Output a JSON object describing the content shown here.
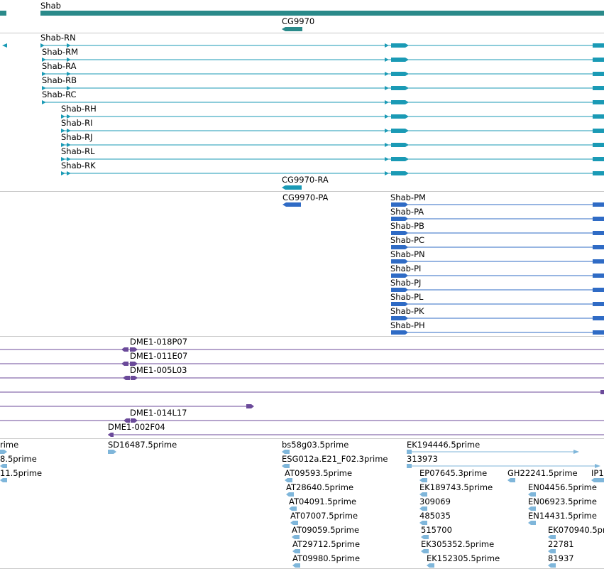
{
  "colors": {
    "gene": "#2a8a8a",
    "rna": "#1a9ab5",
    "protein": "#2f6bc5",
    "clone": "#6b4a9a",
    "est": "#7fb6da",
    "separator": "#c8c8c8"
  },
  "genes": [
    {
      "label": "Shab"
    },
    {
      "label": "CG9970"
    }
  ],
  "transcripts": [
    {
      "label": "Shab-RN"
    },
    {
      "label": "Shab-RM"
    },
    {
      "label": "Shab-RA"
    },
    {
      "label": "Shab-RB"
    },
    {
      "label": "Shab-RC"
    },
    {
      "label": "Shab-RH"
    },
    {
      "label": "Shab-RI"
    },
    {
      "label": "Shab-RJ"
    },
    {
      "label": "Shab-RL"
    },
    {
      "label": "Shab-RK"
    },
    {
      "label": "CG9970-RA"
    }
  ],
  "proteins": [
    {
      "label": "CG9970-PA"
    },
    {
      "label": "Shab-PM"
    },
    {
      "label": "Shab-PA"
    },
    {
      "label": "Shab-PB"
    },
    {
      "label": "Shab-PC"
    },
    {
      "label": "Shab-PN"
    },
    {
      "label": "Shab-PI"
    },
    {
      "label": "Shab-PJ"
    },
    {
      "label": "Shab-PL"
    },
    {
      "label": "Shab-PK"
    },
    {
      "label": "Shab-PH"
    }
  ],
  "clones": [
    {
      "label": "DME1-018P07"
    },
    {
      "label": "DME1-011E07"
    },
    {
      "label": "DME1-005L03"
    },
    {
      "label": ""
    },
    {
      "label": ""
    },
    {
      "label": "DME1-014L17"
    },
    {
      "label": "DME1-002F04"
    }
  ],
  "ests": [
    {
      "label": "rime"
    },
    {
      "label": "8.5prime"
    },
    {
      "label": "11.5prime"
    },
    {
      "label": "SD16487.5prime"
    },
    {
      "label": "bs58g03.5prime"
    },
    {
      "label": "ESG012a.E21_F02.3prime"
    },
    {
      "label": "AT09593.5prime"
    },
    {
      "label": "AT28640.5prime"
    },
    {
      "label": "AT04091.5prime"
    },
    {
      "label": "AT07007.5prime"
    },
    {
      "label": "AT09059.5prime"
    },
    {
      "label": "AT29712.5prime"
    },
    {
      "label": "AT09980.5prime"
    },
    {
      "label": "EK194446.5prime"
    },
    {
      "label": "313973"
    },
    {
      "label": "EP07645.3prime"
    },
    {
      "label": "EK189743.5prime"
    },
    {
      "label": "309069"
    },
    {
      "label": "485035"
    },
    {
      "label": "515700"
    },
    {
      "label": "EK305352.5prime"
    },
    {
      "label": "EK152305.5prime"
    },
    {
      "label": "GH22241.5prime"
    },
    {
      "label": "EN04456.5prime"
    },
    {
      "label": "EN06923.5prime"
    },
    {
      "label": "EN14431.5prime"
    },
    {
      "label": "EK070940.5prime"
    },
    {
      "label": "22781"
    },
    {
      "label": "81937"
    },
    {
      "label": "IP1"
    }
  ]
}
